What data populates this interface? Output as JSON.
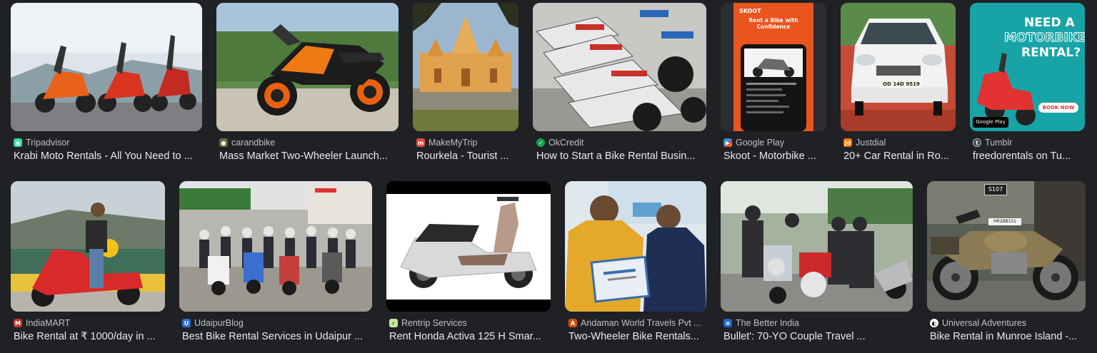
{
  "results": [
    {
      "source": "Tripadvisor",
      "favicon": "tripadvisor-favicon-icon",
      "fav_color": "#34e0a1",
      "title": "Krabi Moto Rentals - All You Need to ..."
    },
    {
      "source": "carandbike",
      "favicon": "carandbike-favicon-icon",
      "fav_color": "#6b6b3a",
      "title": "Mass Market Two-Wheeler Launch..."
    },
    {
      "source": "MakeMyTrip",
      "favicon": "makemytrip-favicon-icon",
      "fav_color": "#e74c3c",
      "title": "Rourkela - Tourist ..."
    },
    {
      "source": "OkCredit",
      "favicon": "okcredit-favicon-icon",
      "fav_color": "#1aa34a",
      "title": "How to Start a Bike Rental Busin..."
    },
    {
      "source": "Google Play",
      "favicon": "google-play-favicon-icon",
      "fav_color": "#4285f4",
      "title": "Skoot - Motorbike ..."
    },
    {
      "source": "Justdial",
      "favicon": "justdial-favicon-icon",
      "fav_color": "#ff7a00",
      "title": "20+ Car Rental in Ro..."
    },
    {
      "source": "Tumblr",
      "favicon": "tumblr-favicon-icon",
      "fav_color": "#35465c",
      "title": "freedorentals on Tu..."
    },
    {
      "source": "IndiaMART",
      "favicon": "indiamart-favicon-icon",
      "fav_color": "#c0392b",
      "title": "Bike Rental at ₹ 1000/day in ..."
    },
    {
      "source": "UdaipurBlog",
      "favicon": "udaipurblog-favicon-icon",
      "fav_color": "#2e6fd8",
      "title": "Best Bike Rental Services in Udaipur ..."
    },
    {
      "source": "Rentrip Services",
      "favicon": "rentrip-favicon-icon",
      "fav_color": "#c8e6a0",
      "title": "Rent Honda Activa 125 H Smar..."
    },
    {
      "source": "Andaman World Travels Pvt ...",
      "favicon": "andaman-favicon-icon",
      "fav_color": "#d35400",
      "title": "Two-Wheeler Bike Rentals..."
    },
    {
      "source": "The Better India",
      "favicon": "the-better-india-favicon-icon",
      "fav_color": "#1e66c8",
      "title": "Bullet': 70-YO Couple Travel ..."
    },
    {
      "source": "Universal Adventures",
      "favicon": "universal-adventures-favicon-icon",
      "fav_color": "#ffffff",
      "title": "Bike Rental in Munroe Island -..."
    }
  ],
  "image_text": {
    "skoot_brand": "SKOOT",
    "skoot_headline": "Rent a Bike with Confidence",
    "freedo_line1": "NEED A",
    "freedo_line2": "MOTORBIKE",
    "freedo_line3": "RENTAL?",
    "freedo_button": "BOOK NOW",
    "google_play_badge": "Google Play",
    "car_plate": "OD 14D 9519",
    "bike_plate": "HR28B1S1",
    "plate_sign": "S107"
  }
}
